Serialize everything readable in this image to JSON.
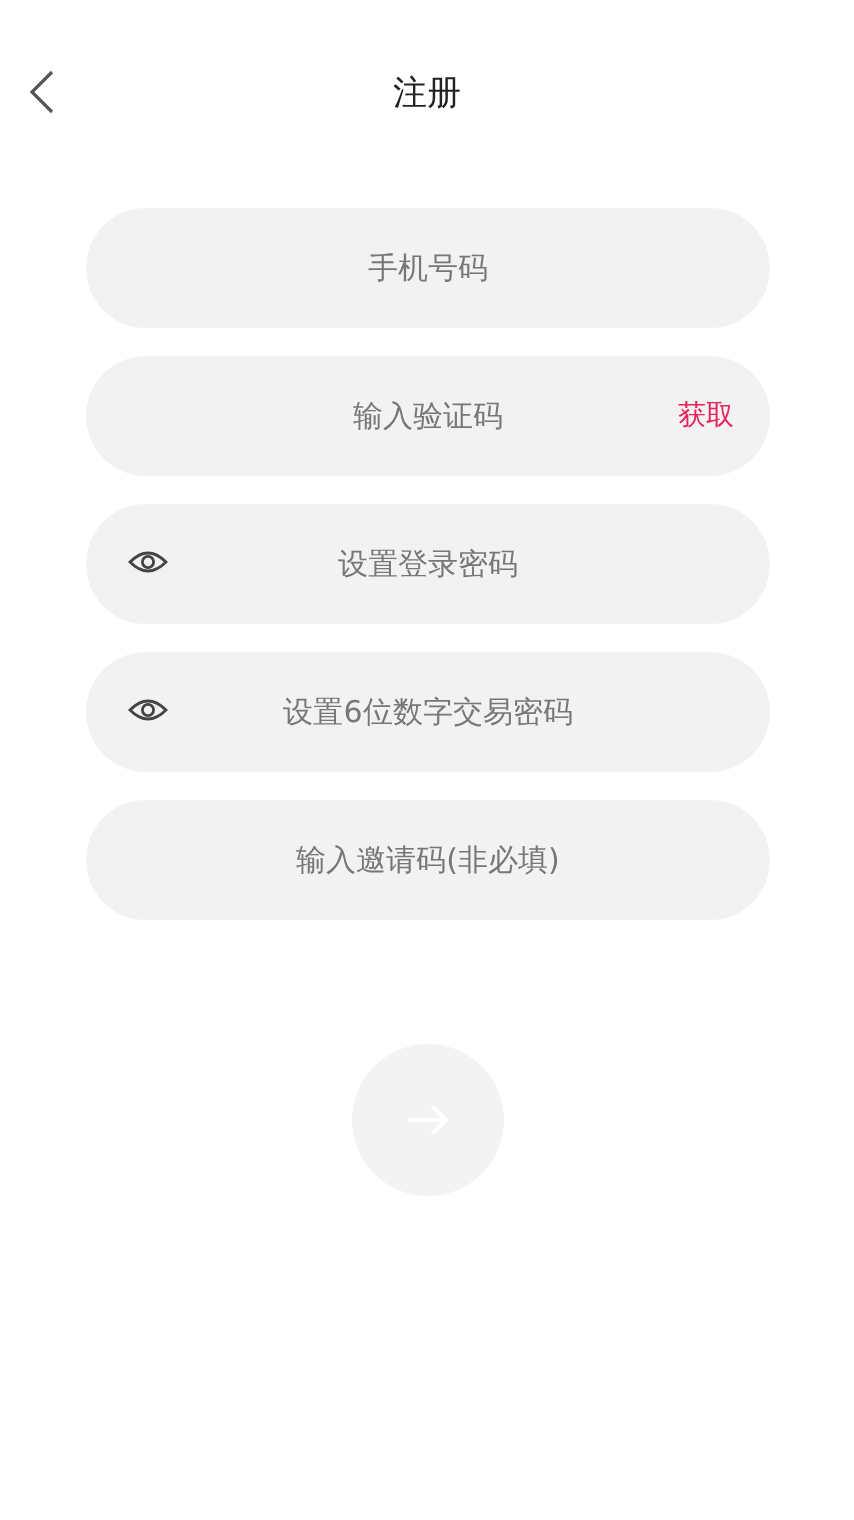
{
  "header": {
    "title": "注册"
  },
  "fields": [
    {
      "kind": "plain",
      "placeholder": "手机号码"
    },
    {
      "kind": "code",
      "placeholder": "输入验证码",
      "action": "获取"
    },
    {
      "kind": "password",
      "placeholder": "设置登录密码"
    },
    {
      "kind": "password",
      "placeholder": "设置6位数字交易密码"
    },
    {
      "kind": "plain",
      "placeholder": "输入邀请码(非必填)"
    }
  ],
  "submit": {
    "disabled": true
  }
}
